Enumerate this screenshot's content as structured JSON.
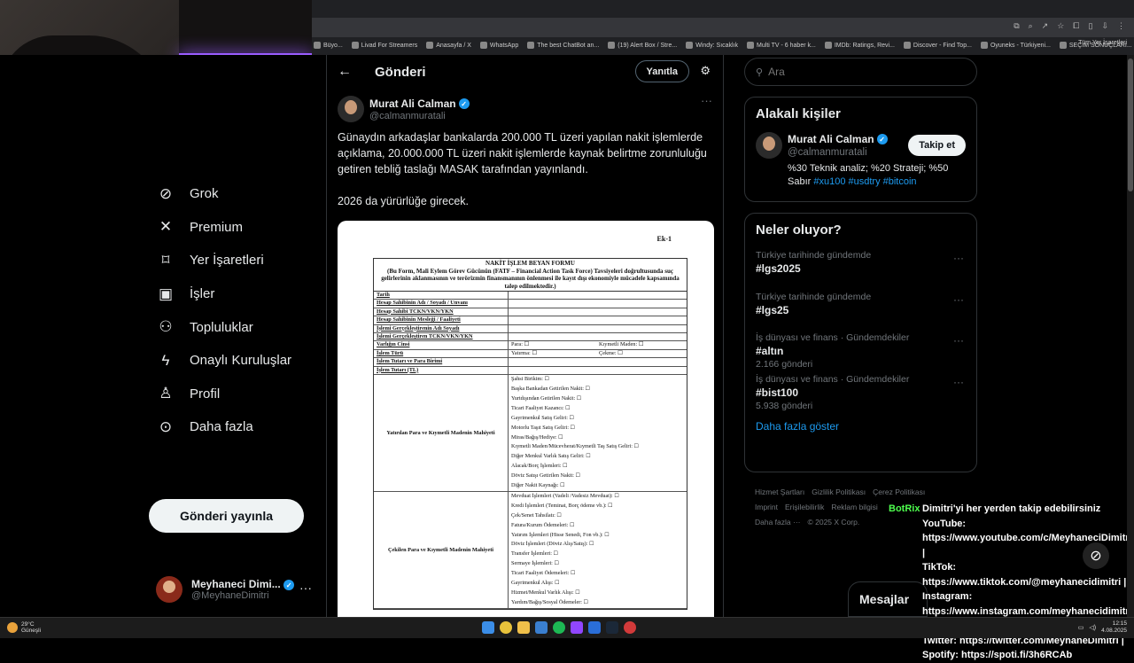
{
  "bookmarks": {
    "items": [
      "Büyo...",
      "Livad For Streamers",
      "Anasayfa / X",
      "WhatsApp",
      "The best ChatBot an...",
      "(19) Alert Box / Stre...",
      "Windy: Sıcaklık",
      "Multi TV - 6 haber k...",
      "IMDb: Ratings, Revi...",
      "Discover - Find Top...",
      "Oyuneks - Türkiyeni...",
      "SEÇİM SONUÇLARI..."
    ],
    "all": "Tüm Yer İşaretleri"
  },
  "nav": {
    "items": [
      {
        "label": "Grok",
        "icon": "grok-icon"
      },
      {
        "label": "Premium",
        "icon": "x-icon"
      },
      {
        "label": "Yer İşaretleri",
        "icon": "bookmark-icon"
      },
      {
        "label": "İşler",
        "icon": "briefcase-icon"
      },
      {
        "label": "Topluluklar",
        "icon": "communities-icon"
      },
      {
        "label": "Onaylı Kuruluşlar",
        "icon": "lightning-icon"
      },
      {
        "label": "Profil",
        "icon": "person-icon"
      },
      {
        "label": "Daha fazla",
        "icon": "more-circle-icon"
      }
    ],
    "post_button": "Gönderi yayınla",
    "profile": {
      "name": "Meyhaneci Dimi...",
      "handle": "@MeyhaneDimitri"
    }
  },
  "main": {
    "header_title": "Gönderi",
    "reply_button": "Yanıtla",
    "author": {
      "name": "Murat Ali Calman",
      "handle": "@calmanmuratali"
    },
    "text_1": "Günaydın arkadaşlar bankalarda 200.000 TL üzeri yapılan nakit işlemlerde açıklama, 20.000.000 TL üzeri nakit işlemlerde kaynak belirtme zorunluluğu getiren tebliğ taslağı MASAK tarafından yayınlandı.",
    "text_2": "2026 da yürürlüğe girecek."
  },
  "document": {
    "ek": "Ek-1",
    "title": "NAKİT İŞLEM BEYAN FORMU",
    "subtitle": "(Bu Form, Mali Eylem Görev Gücünün (FATF – Financial Action Task Force) Tavsiyeleri doğrultusunda suç gelirlerinin aklanmasının ve terörizmin finansmanının önlenmesi ile kayıt dışı ekonomiyle mücadele kapsamında talep edilmektedir.)",
    "rows": [
      "Tarih",
      "Hesap Sahibinin Adı / Soyadı / Unvanı",
      "Hesap Sahibi TCKN/VKN/YKN",
      "Hesap Sahibinin Mesleği / Faaliyeti",
      "İşlemi Gerçekleştirenin Adı Soyadı",
      "İşlemi Gerçekleştiren TCKN/VKN/YKN"
    ],
    "varlik_label": "Varlığın Cinsi",
    "varlik_a": "Para: ☐",
    "varlik_b": "Kıymetli Maden: ☐",
    "islem_label": "İşlem Türü",
    "islem_a": "Yatırma: ☐",
    "islem_b": "Çekme: ☐",
    "tutar_label": "İşlem Tutarı ve Para Birimi",
    "tutar_tl_label": "İşlem Tutarı (TL)",
    "yatirilan_label": "Yatırılan Para ve Kıymetli Madenin Mahiyeti",
    "yatirilan_items": [
      "Şahsi Birikim: ☐",
      "Başka Bankadan Getirilen Nakit: ☐",
      "Yurtdışından Getirilen Nakit: ☐",
      "Ticari Faaliyet Kazancı: ☐",
      "Gayrimenkul Satış Geliri: ☐",
      "Motorlu Taşıt Satış Geliri: ☐",
      "Miras/Bağış/Hediye: ☐",
      "Kıymetli Maden/Mücevherat/Kıymetli Taş Satış Geliri: ☐",
      "Diğer Menkul Varlık Satış Geliri: ☐",
      "Alacak/Borç İşlemleri: ☐",
      "Döviz Satışı Getirilen Nakit: ☐",
      "Diğer Nakit Kaynağı: ☐"
    ],
    "cekilen_label": "Çekilen Para ve Kıymetli Madenin Mahiyeti",
    "cekilen_items": [
      "Mevduat İşlemleri (Vadeli /Vadesiz Mevduat): ☐",
      "Kredi İşlemleri (Teminat, Borç ödeme vb.): ☐",
      "Çek/Senet Tahsilatı: ☐",
      "Fatura/Kurum Ödemeleri: ☐",
      "Yatırım İşlemleri (Hisse Senedi, Fon vb.): ☐",
      "Döviz İşlemleri (Döviz Alış/Satış): ☐",
      "Transfer İşlemleri: ☐",
      "Sermaye İşlemleri: ☐",
      "Ticari Faaliyet Ödemeleri: ☐",
      "Gayrimenkul Alışı: ☐",
      "Hizmet/Menkul Varlık Alışı: ☐",
      "Yardım/Bağış/Sosyal Ödemeler: ☐"
    ]
  },
  "right": {
    "search_placeholder": "Ara",
    "related_title": "Alakalı kişiler",
    "related": {
      "name": "Murat Ali Calman",
      "handle": "@calmanmuratali",
      "bio_text": "%30 Teknik analiz; %20 Strateji; %50 Sabır",
      "bio_tags": "#xu100 #usdtry #bitcoin",
      "follow": "Takip et"
    },
    "trends_title": "Neler oluyor?",
    "trends": [
      {
        "cat": "Türkiye tarihinde gündemde",
        "title": "#lgs2025",
        "count": ""
      },
      {
        "cat": "Türkiye tarihinde gündemde",
        "title": "#lgs25",
        "count": ""
      },
      {
        "cat": "İş dünyası ve finans · Gündemdekiler",
        "title": "#altın",
        "count": "2.166 gönderi"
      },
      {
        "cat": "İş dünyası ve finans · Gündemdekiler",
        "title": "#bist100",
        "count": "5.938 gönderi"
      }
    ],
    "show_more": "Daha fazla göster",
    "footer": [
      "Hizmet Şartları",
      "Gizlilik Politikası",
      "Çerez Politikası",
      "Imprint",
      "Erişilebilirlik",
      "Reklam bilgisi",
      "Daha fazla ···",
      "© 2025 X Corp."
    ]
  },
  "overlay": {
    "bot": "BotRix",
    "lines": [
      "Dimitri'yi her yerden takip edebilirsiniz",
      "YouTube:",
      "https://www.youtube.com/c/MeyhaneciDimitri |",
      "TikTok:",
      "https://www.tiktok.com/@meyhanecidimitri |",
      "Instagram:",
      "https://www.instagram.com/meyhanecidimitri |",
      "Twitter: https://twitter.com/MeyhaneDimitri |",
      "Spotify: https://spoti.fi/3h6RCAb"
    ]
  },
  "messages": "Mesajlar",
  "taskbar": {
    "temp": "29°C",
    "weather": "Güneşli",
    "time": "12:15",
    "date": "4.08.2025"
  }
}
